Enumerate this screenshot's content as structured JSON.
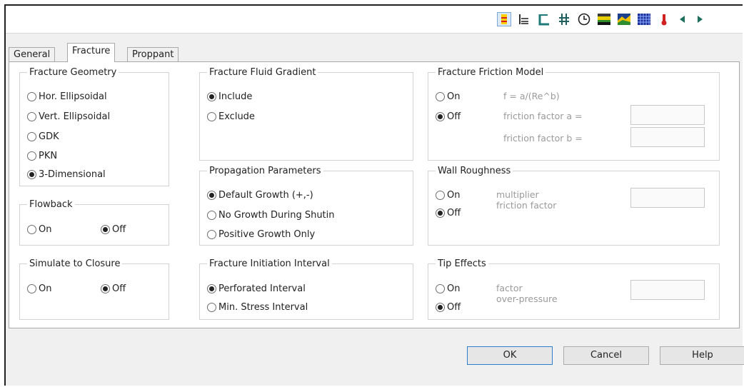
{
  "tabs": [
    {
      "label": "General"
    },
    {
      "label": "Fracture"
    },
    {
      "label": "Proppant"
    }
  ],
  "toolbar": {
    "icons": [
      "fracture-icon",
      "log-icon",
      "wellbore-icon",
      "perforation-icon",
      "clock-icon",
      "layers-icon",
      "map-icon",
      "grid-icon",
      "thermometer-icon",
      "arrow-left-icon",
      "arrow-right-icon"
    ]
  },
  "fracture_geometry": {
    "title": "Fracture Geometry",
    "options": [
      "Hor. Ellipsoidal",
      "Vert. Ellipsoidal",
      "GDK",
      "PKN",
      "3-Dimensional"
    ],
    "selected": "3-Dimensional"
  },
  "flowback": {
    "title": "Flowback",
    "on": "On",
    "off": "Off",
    "selected": "Off"
  },
  "simulate_closure": {
    "title": "Simulate to Closure",
    "on": "On",
    "off": "Off",
    "selected": "Off"
  },
  "fluid_gradient": {
    "title": "Fracture Fluid Gradient",
    "options": [
      "Include",
      "Exclude"
    ],
    "selected": "Include"
  },
  "propagation": {
    "title": "Propagation Parameters",
    "options": [
      "Default Growth (+,-)",
      "No Growth During Shutin",
      "Positive Growth Only"
    ],
    "selected": "Default Growth (+,-)"
  },
  "initiation": {
    "title": "Fracture Initiation Interval",
    "options": [
      "Perforated Interval",
      "Min. Stress Interval"
    ],
    "selected": "Perforated Interval"
  },
  "friction_model": {
    "title": "Fracture Friction Model",
    "on": "On",
    "off": "Off",
    "selected": "Off",
    "formula": "f = a/(Re^b)",
    "label_a": "friction factor a =",
    "label_b": "friction factor b =",
    "value_a": "",
    "value_b": ""
  },
  "wall_roughness": {
    "title": "Wall Roughness",
    "on": "On",
    "off": "Off",
    "selected": "Off",
    "label_line1": "multiplier",
    "label_line2": "friction factor",
    "value": ""
  },
  "tip_effects": {
    "title": "Tip Effects",
    "on": "On",
    "off": "Off",
    "selected": "Off",
    "label_line1": "factor",
    "label_line2": "over-pressure",
    "value": ""
  },
  "buttons": {
    "ok": "OK",
    "cancel": "Cancel",
    "help": "Help"
  }
}
